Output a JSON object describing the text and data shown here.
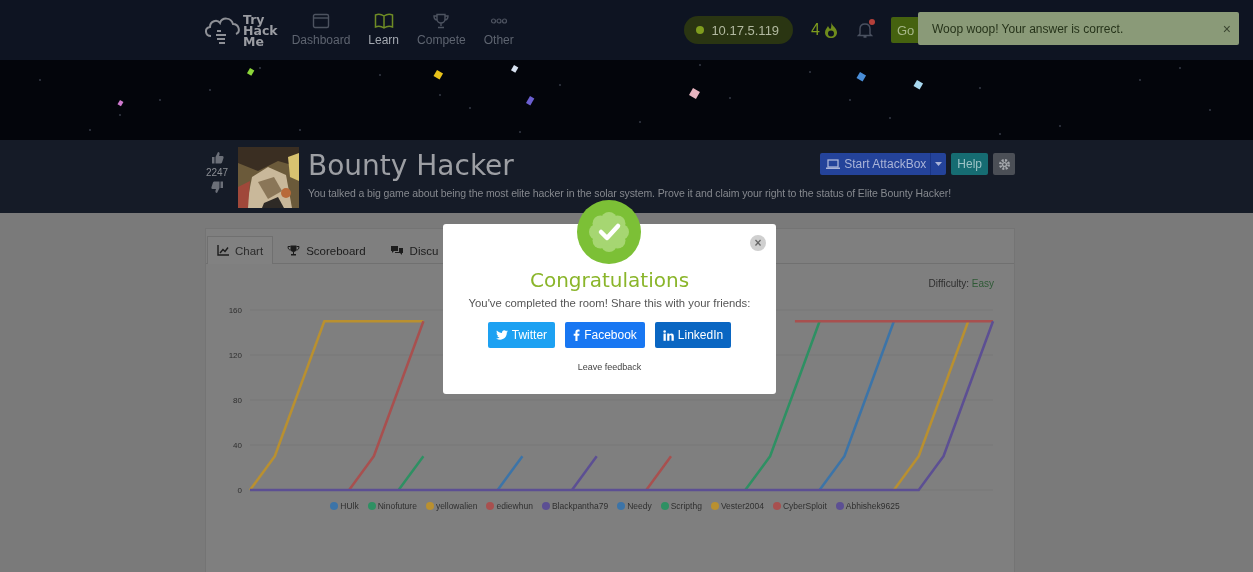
{
  "nav": {
    "logo_lines": [
      "Try",
      "Hack",
      "Me"
    ],
    "items": [
      {
        "label": "Dashboard",
        "selected": false
      },
      {
        "label": "Learn",
        "selected": true
      },
      {
        "label": "Compete",
        "selected": false
      },
      {
        "label": "Other",
        "selected": false
      }
    ],
    "ip": "10.17.5.119",
    "streak": "4",
    "notification_unread": true,
    "go_button": "Go"
  },
  "toast": {
    "message": "Woop woop! Your answer is correct.",
    "close": "×"
  },
  "room": {
    "upvotes": "2247",
    "title": "Bounty Hacker",
    "description": "You talked a big game about being the most elite hacker in the solar system. Prove it and claim your right to the status of Elite Bounty Hacker!",
    "attackbox_button": "Start AttackBox",
    "help_button": "Help"
  },
  "tabs": [
    {
      "label": "Chart",
      "selected": true
    },
    {
      "label": "Scoreboard",
      "selected": false
    },
    {
      "label": "Discu",
      "selected": false
    }
  ],
  "difficulty": {
    "label": "Difficulty:",
    "value": "Easy"
  },
  "chart_data": {
    "type": "line",
    "ylim": [
      0,
      160
    ],
    "yticks": [
      0,
      40,
      80,
      120,
      160
    ],
    "legend": "bottom",
    "series": [
      {
        "name": "HUlk",
        "color": "#3c74a8",
        "values": [
          null,
          null,
          null,
          null,
          null,
          null,
          null,
          null,
          null,
          null,
          null,
          null,
          null,
          null,
          null,
          null,
          null,
          null,
          null,
          null,
          null,
          null,
          null,
          0,
          30,
          90,
          150,
          null,
          null,
          null,
          null
        ]
      },
      {
        "name": "Ninofuture",
        "color": "#2e9063",
        "values": [
          null,
          null,
          null,
          null,
          null,
          null,
          0,
          30,
          null,
          null,
          null,
          null,
          null,
          null,
          null,
          null,
          null,
          null,
          null,
          null,
          null,
          null,
          null,
          null,
          null,
          null,
          null,
          null,
          null,
          null,
          null
        ]
      },
      {
        "name": "yellowalien",
        "color": "#b99030",
        "values": [
          0,
          30,
          90,
          150,
          150,
          150,
          150,
          150,
          null,
          null,
          null,
          null,
          null,
          null,
          null,
          null,
          null,
          null,
          null,
          null,
          null,
          null,
          null,
          null,
          null,
          null,
          null,
          null,
          null,
          null,
          null
        ]
      },
      {
        "name": "ediewhun",
        "color": "#a8504f",
        "values": [
          null,
          null,
          null,
          null,
          0,
          30,
          90,
          150,
          null,
          null,
          null,
          null,
          null,
          null,
          null,
          null,
          null,
          null,
          null,
          null,
          null,
          null,
          null,
          null,
          null,
          null,
          null,
          null,
          null,
          null,
          null
        ]
      },
      {
        "name": "Blackpantha79",
        "color": "#5c4f93",
        "values": [
          null,
          null,
          null,
          null,
          null,
          null,
          null,
          null,
          null,
          null,
          null,
          null,
          null,
          0,
          30,
          null,
          null,
          null,
          null,
          null,
          null,
          null,
          null,
          null,
          null,
          null,
          null,
          null,
          null,
          null,
          null
        ]
      },
      {
        "name": "Needy",
        "color": "#3c74a8",
        "values": [
          null,
          null,
          null,
          null,
          null,
          null,
          null,
          null,
          null,
          null,
          0,
          30,
          null,
          null,
          null,
          null,
          null,
          null,
          null,
          null,
          null,
          null,
          null,
          null,
          null,
          null,
          null,
          null,
          null,
          null,
          null
        ]
      },
      {
        "name": "Scripthg",
        "color": "#2e9063",
        "values": [
          null,
          null,
          null,
          null,
          null,
          null,
          null,
          null,
          null,
          null,
          null,
          null,
          null,
          null,
          null,
          null,
          null,
          null,
          null,
          null,
          0,
          30,
          90,
          150,
          null,
          null,
          null,
          null,
          null,
          null,
          null
        ]
      },
      {
        "name": "Vester2004",
        "color": "#b99030",
        "values": [
          null,
          null,
          null,
          null,
          null,
          null,
          null,
          null,
          null,
          null,
          null,
          null,
          null,
          null,
          null,
          null,
          null,
          null,
          null,
          null,
          null,
          null,
          null,
          null,
          null,
          null,
          0,
          30,
          90,
          150,
          null
        ]
      },
      {
        "name": "CyberSploit",
        "color": "#a8504f",
        "values": [
          null,
          null,
          null,
          null,
          null,
          null,
          null,
          null,
          null,
          null,
          null,
          null,
          null,
          null,
          null,
          null,
          0,
          30,
          null,
          null,
          null,
          null,
          150,
          150,
          150,
          150,
          150,
          150,
          150,
          150,
          150
        ]
      },
      {
        "name": "Abhishek9625",
        "color": "#5c4f93",
        "values": [
          0,
          0,
          0,
          0,
          0,
          0,
          0,
          0,
          0,
          0,
          0,
          0,
          0,
          0,
          0,
          0,
          0,
          0,
          0,
          0,
          0,
          0,
          0,
          0,
          0,
          0,
          0,
          0,
          30,
          90,
          150
        ]
      }
    ]
  },
  "modal": {
    "title": "Congratulations",
    "message": "You've completed the room! Share this with your friends:",
    "share_buttons": [
      {
        "label": "Twitter",
        "kind": "twitter"
      },
      {
        "label": "Facebook",
        "kind": "facebook"
      },
      {
        "label": "LinkedIn",
        "kind": "linkedin"
      }
    ],
    "feedback_link": "Leave feedback",
    "close": "×"
  }
}
